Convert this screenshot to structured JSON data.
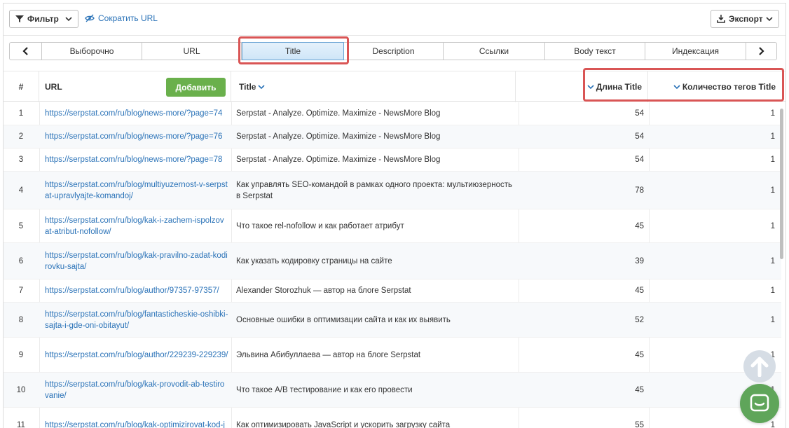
{
  "toolbar": {
    "filter_label": "Фильтр",
    "shorten_label": "Сократить URL",
    "export_label": "Экспорт"
  },
  "tabs": [
    "Выборочно",
    "URL",
    "Title",
    "Description",
    "Ссылки",
    "Body текст",
    "Индексация"
  ],
  "active_tab": "Title",
  "header": {
    "num": "#",
    "url": "URL",
    "add_label": "Добавить",
    "title": "Title",
    "title_length": "Длина Title",
    "title_count": "Количество тегов Title"
  },
  "rows": [
    {
      "n": "1",
      "url": "https://serpstat.com/ru/blog/news-more/?page=74",
      "title": "Serpstat - Analyze. Optimize. Maximize - NewsMore Blog",
      "len": "54",
      "cnt": "1"
    },
    {
      "n": "2",
      "url": "https://serpstat.com/ru/blog/news-more/?page=76",
      "title": "Serpstat - Analyze. Optimize. Maximize - NewsMore Blog",
      "len": "54",
      "cnt": "1"
    },
    {
      "n": "3",
      "url": "https://serpstat.com/ru/blog/news-more/?page=78",
      "title": "Serpstat - Analyze. Optimize. Maximize - NewsMore Blog",
      "len": "54",
      "cnt": "1"
    },
    {
      "n": "4",
      "url": "https://serpstat.com/ru/blog/multiyuzernost-v-serpstat-upravlyajte-komandoj/",
      "title": "Как управлять SEO-командой в рамках одного проекта: мультиюзерность в Serpstat",
      "len": "78",
      "cnt": "1"
    },
    {
      "n": "5",
      "url": "https://serpstat.com/ru/blog/kak-i-zachem-ispolzovat-atribut-nofollow/",
      "title": "Что такое rel-nofollow и как работает атрибут",
      "len": "45",
      "cnt": "1"
    },
    {
      "n": "6",
      "url": "https://serpstat.com/ru/blog/kak-pravilno-zadat-kodirovku-sajta/",
      "title": "Как указать кодировку страницы на сайте",
      "len": "39",
      "cnt": "1"
    },
    {
      "n": "7",
      "url": "https://serpstat.com/ru/blog/author/97357-97357/",
      "title": "Alexander Storozhuk — автор на блоге Serpstat",
      "len": "45",
      "cnt": "1"
    },
    {
      "n": "8",
      "url": "https://serpstat.com/ru/blog/fantasticheskie-oshibki-sajta-i-gde-oni-obitayut/",
      "title": "Основные ошибки в оптимизации сайта и как их выявить",
      "len": "52",
      "cnt": "1"
    },
    {
      "n": "9",
      "url": "https://serpstat.com/ru/blog/author/229239-229239/",
      "title": "Эльвина Абибуллаева — автор на блоге Serpstat",
      "len": "45",
      "cnt": "1"
    },
    {
      "n": "10",
      "url": "https://serpstat.com/ru/blog/kak-provodit-ab-testirovanie/",
      "title": "Что такое A/B тестирование и как его провести",
      "len": "45",
      "cnt": "1"
    },
    {
      "n": "11",
      "url": "https://serpstat.com/ru/blog/kak-optimizirovat-kod-j",
      "title": "Как оптимизировать JavaScript и ускорить загрузку сайта",
      "len": "55",
      "cnt": "1"
    }
  ],
  "colors": {
    "link": "#2b73b8",
    "add_button": "#6ab04c",
    "highlight": "#d95555",
    "chat": "#5fa55a"
  }
}
